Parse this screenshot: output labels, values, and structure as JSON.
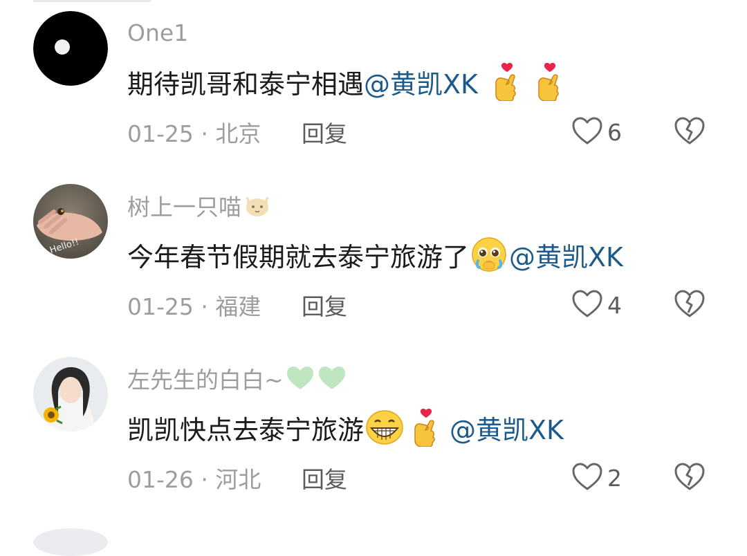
{
  "comments": [
    {
      "username": "One1",
      "text": "期待凯哥和泰宁相遇",
      "mention": "@黄凯XK",
      "emojis": [
        "finger-heart-emoji",
        "finger-heart-emoji"
      ],
      "date_location": "01-25 · 北京",
      "reply_label": "回复",
      "likes": "6"
    },
    {
      "username": "树上一只喵",
      "username_emoji": "cat-face-emoji",
      "text": "今年春节假期就去泰宁旅游了",
      "text_emoji": "pleading-face-emoji",
      "mention": "@黄凯XK",
      "date_location": "01-25 · 福建",
      "reply_label": "回复",
      "likes": "4"
    },
    {
      "username": "左先生的白白~",
      "username_emoji": "green-heart-emoji",
      "text": "凯凯快点去泰宁旅游",
      "text_emojis": [
        "grinning-face-emoji",
        "finger-heart-emoji"
      ],
      "mention": "@黄凯XK",
      "date_location": "01-26 · 河北",
      "reply_label": "回复",
      "likes": "2"
    }
  ],
  "colors": {
    "username": "#9d9d9d",
    "text": "#1b1b1b",
    "mention": "#1b5a8a",
    "meta": "#9d9d9d",
    "action": "#5b5b5b"
  }
}
